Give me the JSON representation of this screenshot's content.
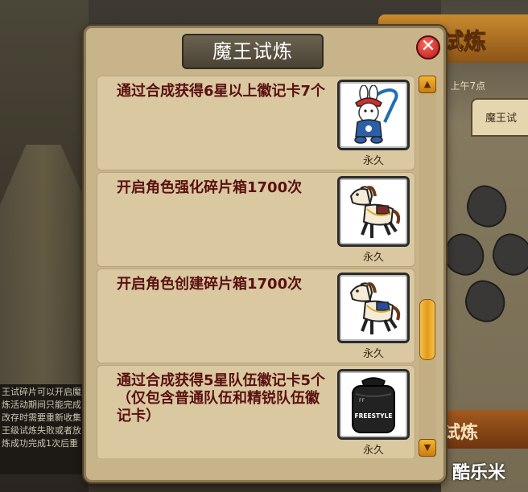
{
  "dialog": {
    "title": "魔王试炼",
    "close_label": "✕"
  },
  "rewards": [
    {
      "text": "通过合成获得6星以上徽记卡7个",
      "duration": "永久",
      "icon": "rabbit-toy-icon"
    },
    {
      "text": "开启角色强化碎片箱1700次",
      "duration": "永久",
      "icon": "toy-horse-icon"
    },
    {
      "text": "开启角色创建碎片箱1700次",
      "duration": "永久",
      "icon": "toy-horse-icon"
    },
    {
      "text": "通过合成获得5星队伍徽记卡5个（仅包含普通队伍和精锐队伍徽记卡）",
      "duration": "永久",
      "icon": "black-backpack-icon"
    }
  ],
  "item_icon_text": {
    "backpack_logo": "FREESTYLE"
  },
  "scroll": {
    "up_label": "▲",
    "down_label": "▼"
  },
  "background": {
    "banner_text": "试炼",
    "time_text": "8 上午7点",
    "tab_label": "魔王试",
    "button_label": "试炼",
    "left_text_lines": [
      "王试碎片可以开启魔王",
      "炼活动期间只能完成",
      "改存时需要重新收集",
      "王级试炼失败或者放",
      "炼成功完成1次后重"
    ]
  },
  "watermark": "酷乐米",
  "colors": {
    "row_text": "#5a1010",
    "panel": "#c8b48a",
    "accent": "#e49a1a",
    "close": "#b4141a"
  }
}
